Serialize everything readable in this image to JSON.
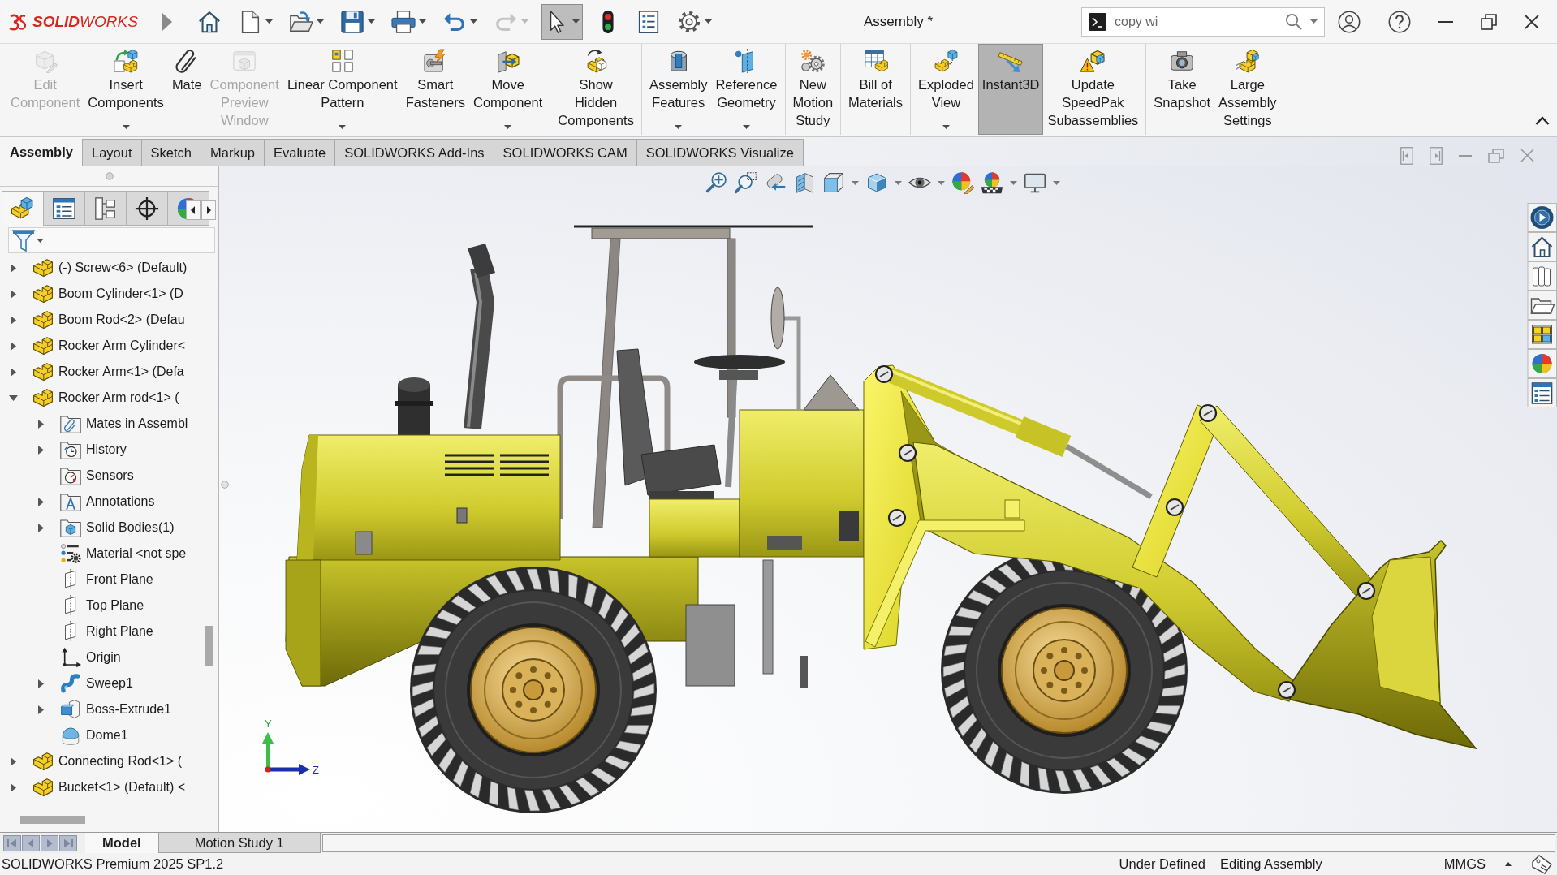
{
  "title_bar": {
    "logo": "**SOLID**WORKS",
    "document_title": "Assembly *",
    "search": {
      "value": "copy wi"
    }
  },
  "quick_access": [
    {
      "kind": "home",
      "dropdown": false,
      "disabled": false,
      "active": false
    },
    {
      "kind": "new",
      "dropdown": true,
      "disabled": false,
      "active": false
    },
    {
      "kind": "open",
      "dropdown": true,
      "disabled": false,
      "active": false
    },
    {
      "kind": "save",
      "dropdown": true,
      "disabled": false,
      "active": false
    },
    {
      "kind": "print",
      "dropdown": true,
      "disabled": false,
      "active": false
    },
    {
      "kind": "undo",
      "dropdown": true,
      "disabled": false,
      "active": false
    },
    {
      "kind": "redo",
      "dropdown": true,
      "disabled": true,
      "active": false
    },
    {
      "kind": "select",
      "dropdown": true,
      "disabled": false,
      "active": true
    },
    {
      "kind": "rebuild",
      "dropdown": false,
      "disabled": false,
      "active": false
    },
    {
      "kind": "properties",
      "dropdown": false,
      "disabled": false,
      "active": false
    },
    {
      "kind": "options",
      "dropdown": true,
      "disabled": false,
      "active": false
    }
  ],
  "ribbon": {
    "groups": [
      {
        "commands": [
          {
            "kind": "edit",
            "label": "Edit\nComponent",
            "disabled": true,
            "dropdown": false,
            "active": false
          },
          {
            "kind": "insert",
            "label": "Insert\nComponents",
            "disabled": false,
            "dropdown": true,
            "active": false
          },
          {
            "kind": "mate",
            "label": "Mate",
            "disabled": false,
            "dropdown": false,
            "active": false
          },
          {
            "kind": "preview",
            "label": "Component\nPreview\nWindow",
            "disabled": true,
            "dropdown": false,
            "active": false
          },
          {
            "kind": "pattern",
            "label": "Linear Component\nPattern",
            "disabled": false,
            "dropdown": true,
            "active": false
          },
          {
            "kind": "fasteners",
            "label": "Smart\nFasteners",
            "disabled": false,
            "dropdown": false,
            "active": false
          },
          {
            "kind": "move",
            "label": "Move\nComponent",
            "disabled": false,
            "dropdown": true,
            "active": false
          }
        ]
      },
      {
        "commands": [
          {
            "kind": "hidden",
            "label": "Show\nHidden\nComponents",
            "disabled": false,
            "dropdown": false,
            "active": false
          }
        ]
      },
      {
        "commands": [
          {
            "kind": "features",
            "label": "Assembly\nFeatures",
            "disabled": false,
            "dropdown": true,
            "active": false
          },
          {
            "kind": "reference",
            "label": "Reference\nGeometry",
            "disabled": false,
            "dropdown": true,
            "active": false
          }
        ]
      },
      {
        "commands": [
          {
            "kind": "motion",
            "label": "New\nMotion\nStudy",
            "disabled": false,
            "dropdown": false,
            "active": false
          }
        ]
      },
      {
        "commands": [
          {
            "kind": "bom",
            "label": "Bill of\nMaterials",
            "disabled": false,
            "dropdown": false,
            "active": false
          }
        ]
      },
      {
        "commands": [
          {
            "kind": "exploded",
            "label": "Exploded\nView",
            "disabled": false,
            "dropdown": true,
            "active": false
          },
          {
            "kind": "instant3d",
            "label": "Instant3D",
            "disabled": false,
            "dropdown": false,
            "active": true
          },
          {
            "kind": "speedpak",
            "label": "Update\nSpeedPak\nSubassemblies",
            "disabled": false,
            "dropdown": false,
            "active": false
          }
        ]
      },
      {
        "commands": [
          {
            "kind": "snapshot",
            "label": "Take\nSnapshot",
            "disabled": false,
            "dropdown": false,
            "active": false
          },
          {
            "kind": "settings",
            "label": "Large\nAssembly\nSettings",
            "disabled": false,
            "dropdown": false,
            "active": false
          }
        ]
      }
    ]
  },
  "command_tabs": [
    {
      "label": "Assembly",
      "selected": true
    },
    {
      "label": "Layout",
      "selected": false
    },
    {
      "label": "Sketch",
      "selected": false
    },
    {
      "label": "Markup",
      "selected": false
    },
    {
      "label": "Evaluate",
      "selected": false
    },
    {
      "label": "SOLIDWORKS Add-Ins",
      "selected": false
    },
    {
      "label": "SOLIDWORKS CAM",
      "selected": false
    },
    {
      "label": "SOLIDWORKS Visualize",
      "selected": false
    }
  ],
  "feature_manager": {
    "panel_tabs": [
      {
        "kind": "feature",
        "selected": true
      },
      {
        "kind": "property",
        "selected": false
      },
      {
        "kind": "configuration",
        "selected": false
      },
      {
        "kind": "dimxpert",
        "selected": false
      },
      {
        "kind": "display",
        "selected": false
      }
    ],
    "tree": [
      {
        "label": "(-) Screw<6> (Default)",
        "kind": "part",
        "expanded": false
      },
      {
        "label": "Boom Cylinder<1> (D",
        "kind": "part",
        "expanded": false
      },
      {
        "label": "Boom Rod<2> (Defau",
        "kind": "part",
        "expanded": false
      },
      {
        "label": "Rocker Arm Cylinder<",
        "kind": "part",
        "expanded": false
      },
      {
        "label": "Rocker Arm<1> (Defa",
        "kind": "part",
        "expanded": false
      },
      {
        "label": "Rocker Arm rod<1> (",
        "kind": "part",
        "expanded": true,
        "children": [
          {
            "label": "Mates in Assembl",
            "kind": "mates",
            "expanded": false
          },
          {
            "label": "History",
            "kind": "history",
            "expanded": false
          },
          {
            "label": "Sensors",
            "kind": "sensors"
          },
          {
            "label": "Annotations",
            "kind": "annotations",
            "expanded": false
          },
          {
            "label": "Solid Bodies(1)",
            "kind": "bodies",
            "expanded": false
          },
          {
            "label": "Material <not spe",
            "kind": "material"
          },
          {
            "label": "Front Plane",
            "kind": "plane"
          },
          {
            "label": "Top Plane",
            "kind": "plane"
          },
          {
            "label": "Right Plane",
            "kind": "plane"
          },
          {
            "label": "Origin",
            "kind": "origin"
          },
          {
            "label": "Sweep1",
            "kind": "sweep",
            "expanded": false
          },
          {
            "label": "Boss-Extrude1",
            "kind": "extrude",
            "expanded": false
          },
          {
            "label": "Dome1",
            "kind": "dome"
          }
        ]
      },
      {
        "label": "Connecting Rod<1> (",
        "kind": "part",
        "expanded": false
      },
      {
        "label": "Bucket<1> (Default) <",
        "kind": "part",
        "expanded": false
      }
    ]
  },
  "view_toolbar": [
    {
      "kind": "zoomfit",
      "dropdown": false
    },
    {
      "kind": "zoomarea",
      "dropdown": false
    },
    {
      "kind": "previous",
      "dropdown": false
    },
    {
      "kind": "section",
      "dropdown": false
    },
    {
      "kind": "orientation",
      "dropdown": true
    },
    {
      "kind": "display",
      "dropdown": true
    },
    {
      "kind": "hide",
      "dropdown": true
    },
    {
      "kind": "appearance",
      "dropdown": false
    },
    {
      "kind": "scene",
      "dropdown": true
    },
    {
      "kind": "settings",
      "dropdown": true
    }
  ],
  "triad": {
    "y_label": "Y",
    "z_label": "Z"
  },
  "bottom_tabs": [
    {
      "label": "Model",
      "selected": true
    },
    {
      "label": "Motion Study 1",
      "selected": false
    }
  ],
  "status_bar": {
    "product": "SOLIDWORKS Premium 2025 SP1.2",
    "definition": "Under Defined",
    "mode": "Editing Assembly",
    "units": "MMGS"
  }
}
